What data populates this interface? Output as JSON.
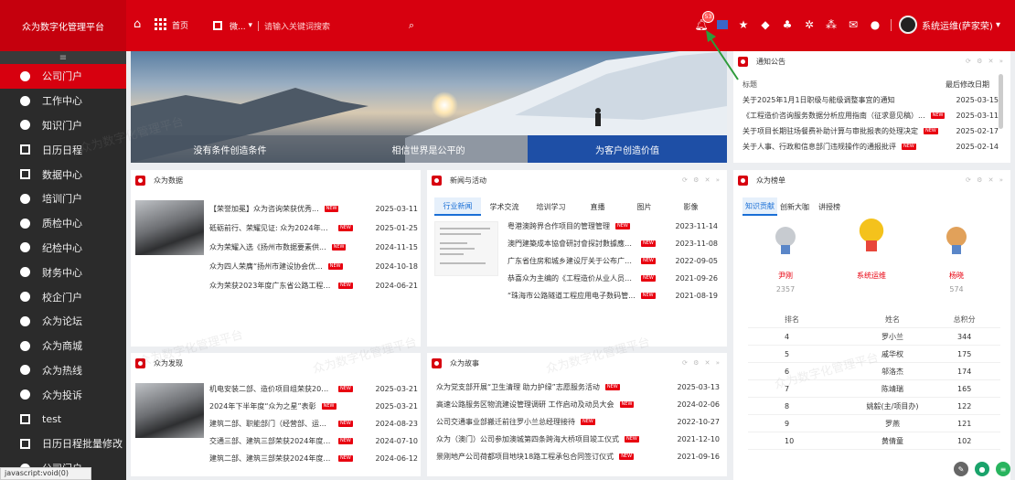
{
  "topbar": {
    "brand": "众为数字化管理平台",
    "home_label": "首页",
    "app_name": "微...",
    "search_placeholder": "请输入关键词搜索",
    "notif_count": "53",
    "user": "系统运维(萨家荣)"
  },
  "sidebar": {
    "menu_icon": "≡",
    "items": [
      {
        "label": "公司门户",
        "active": true,
        "icon": "circle"
      },
      {
        "label": "工作中心",
        "icon": "circle"
      },
      {
        "label": "知识门户",
        "icon": "circle"
      },
      {
        "label": "日历日程",
        "icon": "calendar-icon"
      },
      {
        "label": "数据中心",
        "icon": "bar-chart-icon"
      },
      {
        "label": "培训门户",
        "icon": "circle"
      },
      {
        "label": "质检中心",
        "icon": "circle"
      },
      {
        "label": "纪检中心",
        "icon": "circle"
      },
      {
        "label": "财务中心",
        "icon": "circle"
      },
      {
        "label": "校企门户",
        "icon": "circle"
      },
      {
        "label": "众为论坛",
        "icon": "circle"
      },
      {
        "label": "众为商城",
        "icon": "circle"
      },
      {
        "label": "众为热线",
        "icon": "circle"
      },
      {
        "label": "众为投诉",
        "icon": "circle"
      },
      {
        "label": "test",
        "icon": "grid-icon"
      },
      {
        "label": "日历日程批量修改",
        "icon": "calendar-icon"
      },
      {
        "label": "公司门户",
        "icon": "circle"
      }
    ]
  },
  "status_bar": "javascript:void(0)",
  "banner": {
    "captions": [
      "没有条件创造条件",
      "相信世界是公平的",
      "为客户创造价值"
    ]
  },
  "notice": {
    "title": "通知公告",
    "col_title": "标题",
    "col_date": "最后修改日期",
    "rows": [
      {
        "title": "关于2025年1月1日职级与能级调整事宜的通知",
        "date": "2025-03-15",
        "new": false
      },
      {
        "title": "《工程造价咨询服务数据分析应用指南（征求意见稿）...",
        "date": "2025-03-11",
        "new": true
      },
      {
        "title": "关于项目长期驻场餐费补助计算与审批报表的处理决定",
        "date": "2025-02-17",
        "new": true
      },
      {
        "title": "关于人事、行政和信息部门违规操作的通报批评",
        "date": "2025-02-14",
        "new": true
      }
    ]
  },
  "zw_data": {
    "title": "众为数据",
    "rows": [
      {
        "title": "【荣誉加冕】众为咨询荣获优秀...",
        "date": "2025-03-11"
      },
      {
        "title": "砥砺前行、荣耀见证: 众为2024年收...",
        "date": "2025-01-25"
      },
      {
        "title": "众为荣耀入选《扬州市数据要素供...",
        "date": "2024-11-15"
      },
      {
        "title": "众为四人荣膺“扬州市建设协会优...",
        "date": "2024-10-18"
      },
      {
        "title": "众为荣获2023年度广东省公路工程从...",
        "date": "2024-06-21"
      }
    ]
  },
  "news": {
    "title": "新闻与活动",
    "tabs": [
      "行业新闻",
      "学术交流",
      "培训学习",
      "直播",
      "图片",
      "影像"
    ],
    "rows": [
      {
        "title": "粤港澳跨界合作项目的管理管理",
        "date": "2023-11-14"
      },
      {
        "title": "澳門建築成本協會研討會探討數據應用方向",
        "date": "2023-11-08"
      },
      {
        "title": "广东省住房和城乡建设厅关于公布广东...",
        "date": "2022-09-05"
      },
      {
        "title": "恭喜众为主编的《工程造价从业人员信...",
        "date": "2021-09-26"
      },
      {
        "title": "“珠海市公路隧道工程应用电子数码管...",
        "date": "2021-08-19"
      }
    ]
  },
  "ranking": {
    "title": "众为榜单",
    "tabs": [
      "知识贡献",
      "创新大咖",
      "讲授榜"
    ],
    "top3": [
      {
        "name": "尹刚",
        "score": "2357",
        "rank": "2"
      },
      {
        "name": "系统运维",
        "score": "",
        "rank": "1"
      },
      {
        "name": "杨晓",
        "score": "574",
        "rank": "3"
      }
    ],
    "headers": [
      "排名",
      "姓名",
      "总积分"
    ],
    "rows": [
      {
        "rank": "4",
        "name": "罗小兰",
        "score": "344"
      },
      {
        "rank": "5",
        "name": "戚华权",
        "score": "175"
      },
      {
        "rank": "6",
        "name": "邬洛杰",
        "score": "174"
      },
      {
        "rank": "7",
        "name": "陈靖瑞",
        "score": "165"
      },
      {
        "rank": "8",
        "name": "姚毅(主/项目办)",
        "score": "122"
      },
      {
        "rank": "9",
        "name": "罗燕",
        "score": "121"
      },
      {
        "rank": "10",
        "name": "黄倩童",
        "score": "102"
      }
    ]
  },
  "zw_show": {
    "title": "众为发现",
    "rows": [
      {
        "title": "机电安装二部、造价项目组荣获2025...",
        "date": "2025-03-21"
      },
      {
        "title": "2024年下半年度“众为之星”表彰",
        "date": "2025-03-21"
      },
      {
        "title": "建筑二部、职能部门（经营部、运营...",
        "date": "2024-08-23"
      },
      {
        "title": "交通三部、建筑三部荣获2024年度5月...",
        "date": "2024-07-10"
      },
      {
        "title": "建筑二部、建筑三部荣获2024年度4月...",
        "date": "2024-06-12"
      }
    ]
  },
  "zw_story": {
    "title": "众为故事",
    "rows": [
      {
        "title": "众为党支部开展“卫生清理 助力护绿”志愿服务活动",
        "date": "2025-03-13"
      },
      {
        "title": "高速公路服务区物流建设管理调研 工作启动及动员大会",
        "date": "2024-02-06"
      },
      {
        "title": "公司交通事业部搬迁前往罗小兰总经理接待",
        "date": "2022-10-27"
      },
      {
        "title": "众为（澳门）公司参加澳城第四条跨海大桥项目竣工仪式",
        "date": "2021-12-10"
      },
      {
        "title": "景刚地产公司荷都项目地块18路工程承包合同签订仪式",
        "date": "2021-09-16"
      }
    ]
  },
  "new_label": "NEW",
  "watermark_text": "众为数字化管理平台",
  "colors": {
    "brand_red": "#d7000f",
    "active_blue": "#1a6fd6"
  }
}
